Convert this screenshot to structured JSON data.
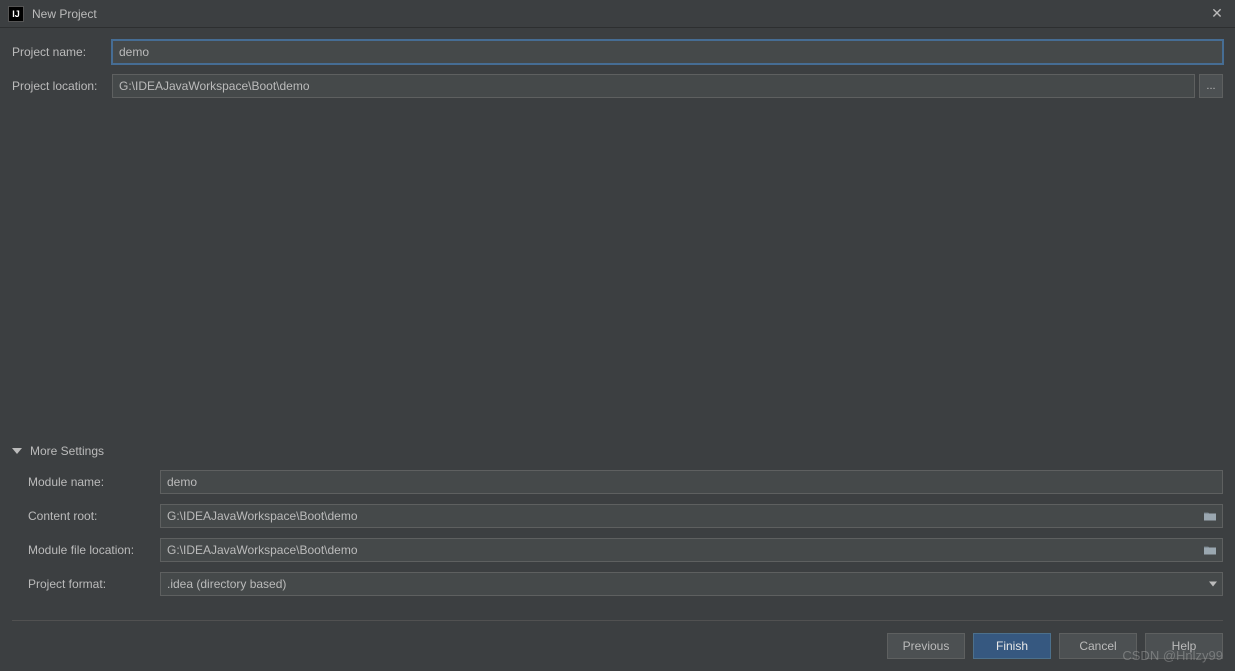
{
  "window": {
    "title": "New Project"
  },
  "form": {
    "projectName": {
      "label": "Project name:",
      "value": "demo"
    },
    "projectLocation": {
      "label": "Project location:",
      "value": "G:\\IDEAJavaWorkspace\\Boot\\demo"
    }
  },
  "moreSettings": {
    "header": "More Settings",
    "moduleName": {
      "label": "Module name:",
      "value": "demo"
    },
    "contentRoot": {
      "label": "Content root:",
      "value": "G:\\IDEAJavaWorkspace\\Boot\\demo"
    },
    "moduleFileLocation": {
      "label": "Module file location:",
      "value": "G:\\IDEAJavaWorkspace\\Boot\\demo"
    },
    "projectFormat": {
      "label": "Project format:",
      "value": ".idea (directory based)"
    }
  },
  "buttons": {
    "previous": "Previous",
    "finish": "Finish",
    "cancel": "Cancel",
    "help": "Help",
    "browse": "..."
  },
  "watermark": "CSDN @Hnlzy99"
}
